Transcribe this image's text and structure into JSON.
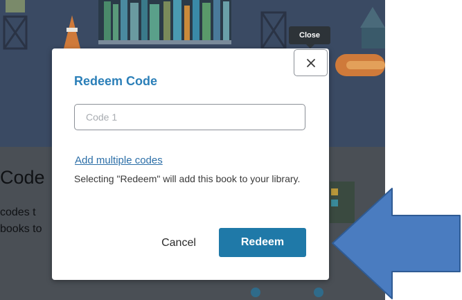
{
  "background": {
    "partial_heading": "Code",
    "partial_line_1": "codes t",
    "partial_line_2": "books to"
  },
  "modal": {
    "title": "Redeem Code",
    "code_input": {
      "placeholder": "Code 1",
      "value": ""
    },
    "add_multiple_link": "Add multiple codes",
    "info_text": "Selecting \"Redeem\" will add this book to your library.",
    "cancel_label": "Cancel",
    "redeem_label": "Redeem"
  },
  "close_tooltip": "Close",
  "icons": {
    "close": "close-icon",
    "annotation_arrow": "arrow-left-icon"
  },
  "colors": {
    "accent": "#1f79a8",
    "title": "#2b7fb8",
    "arrow_fill": "#4a7cc0",
    "arrow_stroke": "#2f5b94"
  }
}
